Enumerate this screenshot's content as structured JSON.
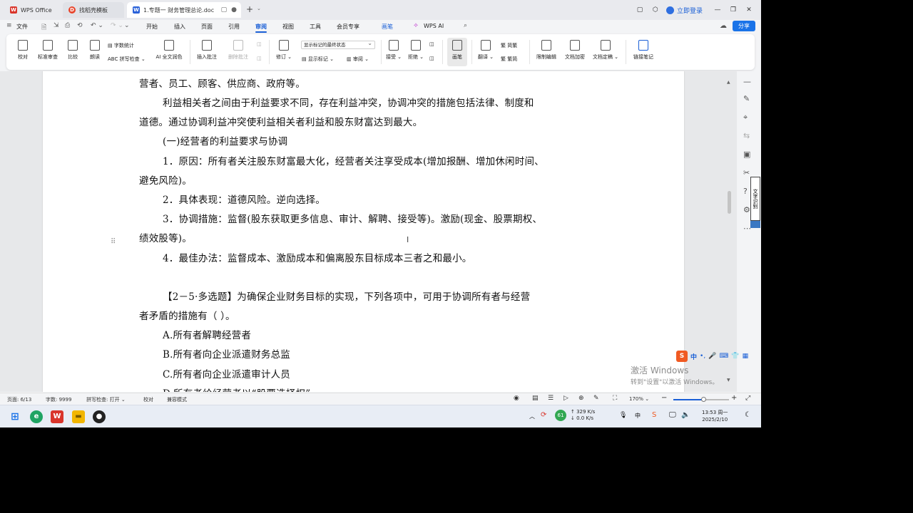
{
  "colors": {
    "accent": "#1a5fd6",
    "share_bg": "#1a73e8",
    "wps_red": "#d9352b"
  },
  "tabs": [
    {
      "label": "WPS Office",
      "icon": "wps-logo-icon"
    },
    {
      "label": "找稻壳模板",
      "icon": "docer-logo-icon"
    },
    {
      "label": "1.专题一  财务管理总论.doc",
      "icon": "word-doc-icon"
    }
  ],
  "window": {
    "login": "立即登录"
  },
  "menu": {
    "file": "文件",
    "items": [
      "开始",
      "插入",
      "页面",
      "引用",
      "审阅",
      "视图",
      "工具",
      "会员专享",
      "画笔"
    ],
    "active": "审阅",
    "wps_ai": "WPS AI",
    "share": "分享"
  },
  "ribbon": {
    "proofread": "校对",
    "standard_review": "标准审查",
    "compare": "比较",
    "read_aloud": "朗读",
    "word_count": "字数统计",
    "spell_check": "拼写检查",
    "ai_color": "AI 全文润色",
    "insert_comment": "插入批注",
    "delete_comment": "删除批注",
    "revise": "修订",
    "markup_select": "显示标记的最终状态",
    "show_markup": "显示标记",
    "review_pane": "审阅",
    "accept": "接受",
    "reject": "拒绝",
    "pen": "画笔",
    "translate": "翻译",
    "simp_trad": "简繁",
    "trad_simp": "繁简",
    "restrict_edit": "限制编辑",
    "doc_encrypt": "文档加密",
    "doc_finalize": "文档定稿",
    "link_note": "链接笔记"
  },
  "document": {
    "lines": [
      "营者、员工、顾客、供应商、政府等。",
      "利益相关者之间由于利益要求不同，存在利益冲突，协调冲突的措施包括法律、制度和",
      "道德。通过协调利益冲突使利益相关者利益和股东财富达到最大。",
      "(一)经营者的利益要求与协调",
      "1．原因：所有者关注股东财富最大化，经营者关注享受成本(增加报酬、增加休闲时间、",
      "避免风险)。",
      "2．具体表现：道德风险。逆向选择。",
      "3．协调措施：监督(股东获取更多信息、审计、解聘、接受等)。激励(现金、股票期权、",
      "绩效股等)。",
      "4．最佳办法：监督成本、激励成本和偏离股东目标成本三者之和最小。",
      "【2－5·多选题】为确保企业财务目标的实现，下列各项中，可用于协调所有者与经营",
      "者矛盾的措施有（   ）。",
      "A.所有者解聘经营者",
      "B.所有者向企业派遣财务总监",
      "C.所有者向企业派遣审计人员",
      "D.所有者给经营者以“股票选择权”"
    ]
  },
  "side_tool": "文字识别",
  "ime": {
    "mode": "中"
  },
  "activation": {
    "title": "激活 Windows",
    "subtitle": "转到\"设置\"以激活 Windows。"
  },
  "status": {
    "page": "页面: 6/13",
    "words": "字数: 9999",
    "spell": "拼写检查: 打开",
    "proof": "校对",
    "compat": "兼容模式",
    "zoom": "170%",
    "zoom_level": 0.54
  },
  "taskbar": {
    "net_badge": "61",
    "speed_up": "↑ 329 K/s",
    "speed_down": "↓ 0.0 K/s",
    "ime_tray": "中",
    "time": "13:53 周一",
    "date": "2025/2/10"
  }
}
